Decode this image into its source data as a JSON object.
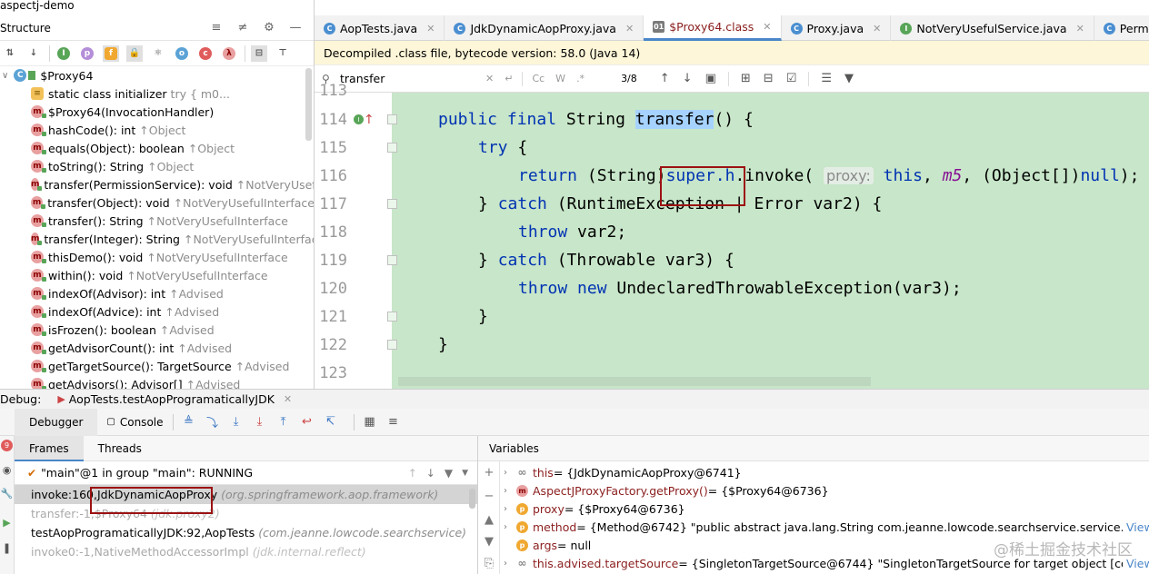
{
  "project": {
    "title": "aspectj-demo"
  },
  "structure": {
    "title": "Structure",
    "root": "$Proxy64",
    "items": [
      {
        "label": "static class initializer",
        "sub": "try {              m0...",
        "icon": "static-initializer-icon"
      },
      {
        "label": "$Proxy64(InvocationHandler)",
        "sub": "",
        "icon": "method-icon"
      },
      {
        "label": "hashCode(): int",
        "sub": "↑Object",
        "icon": "method-icon"
      },
      {
        "label": "equals(Object): boolean",
        "sub": "↑Object",
        "icon": "method-icon"
      },
      {
        "label": "toString(): String",
        "sub": "↑Object",
        "icon": "method-icon"
      },
      {
        "label": "transfer(PermissionService): void",
        "sub": "↑NotVeryUseful",
        "icon": "method-icon"
      },
      {
        "label": "transfer(Object): void",
        "sub": "↑NotVeryUsefulInterface",
        "icon": "method-icon"
      },
      {
        "label": "transfer(): String",
        "sub": "↑NotVeryUsefulInterface",
        "icon": "method-icon"
      },
      {
        "label": "transfer(Integer): String",
        "sub": "↑NotVeryUsefulInterface",
        "icon": "method-icon"
      },
      {
        "label": "thisDemo(): void",
        "sub": "↑NotVeryUsefulInterface",
        "icon": "method-icon"
      },
      {
        "label": "within(): void",
        "sub": "↑NotVeryUsefulInterface",
        "icon": "method-icon"
      },
      {
        "label": "indexOf(Advisor): int",
        "sub": "↑Advised",
        "icon": "method-icon"
      },
      {
        "label": "indexOf(Advice): int",
        "sub": "↑Advised",
        "icon": "method-icon"
      },
      {
        "label": "isFrozen(): boolean",
        "sub": "↑Advised",
        "icon": "method-icon"
      },
      {
        "label": "getAdvisorCount(): int",
        "sub": "↑Advised",
        "icon": "method-icon"
      },
      {
        "label": "getTargetSource(): TargetSource",
        "sub": "↑Advised",
        "icon": "method-icon"
      },
      {
        "label": "getAdvisors(): Advisor[]",
        "sub": "↑Advised",
        "icon": "method-icon"
      }
    ]
  },
  "editor": {
    "tabs": [
      {
        "label": "AopTests.java",
        "active": false
      },
      {
        "label": "JdkDynamicAopProxy.java",
        "active": false
      },
      {
        "label": "$Proxy64.class",
        "active": true
      },
      {
        "label": "Proxy.java",
        "active": false
      },
      {
        "label": "NotVeryUsefulService.java",
        "active": false
      },
      {
        "label": "PermissionService.ja",
        "active": false
      }
    ],
    "banner": "Decompiled .class file, bytecode version: 58.0 (Java 14)",
    "search": {
      "value": "transfer",
      "match_count": "3/8"
    },
    "lines": [
      {
        "num": "113"
      },
      {
        "num": "114"
      },
      {
        "num": "115"
      },
      {
        "num": "116"
      },
      {
        "num": "117"
      },
      {
        "num": "118"
      },
      {
        "num": "119"
      },
      {
        "num": "120"
      },
      {
        "num": "121"
      },
      {
        "num": "122"
      },
      {
        "num": "123"
      }
    ],
    "code": {
      "l114": [
        "public final ",
        "String ",
        "transfer",
        "() {"
      ],
      "l115": [
        "try",
        " {"
      ],
      "l116": [
        "return",
        " (String)",
        "super.h",
        ".invoke( ",
        "proxy:",
        " this",
        ", ",
        "m5",
        ", (Object[])",
        "null",
        ");"
      ],
      "l117": [
        "} ",
        "catch",
        " (RuntimeException | Error var2) {"
      ],
      "l118": [
        "throw",
        " var2;"
      ],
      "l119": [
        "} ",
        "catch",
        " (Throwable var3) {"
      ],
      "l120": [
        "throw",
        " ",
        "new",
        " UndeclaredThrowableException(var3);"
      ],
      "l121": [
        "}"
      ],
      "l122": [
        "}"
      ]
    }
  },
  "debug": {
    "label": "Debug:",
    "session": "AopTests.testAopProgramaticallyJDK",
    "tabs": {
      "debugger": "Debugger",
      "console": "Console"
    },
    "frames_tab": "Frames",
    "threads_tab": "Threads",
    "thread": "\"main\"@1 in group \"main\": RUNNING",
    "frames": [
      {
        "method": "invoke:160, ",
        "cls": "JdkDynamicAopProxy",
        "pkg": "(org.springframework.aop.framework)",
        "selected": true,
        "grey": false
      },
      {
        "method": "transfer:-1, ",
        "cls": "$Proxy64",
        "pkg": "(jdk.proxy2)",
        "selected": false,
        "grey": true
      },
      {
        "method": "testAopProgramaticallyJDK:92, ",
        "cls": "AopTests",
        "pkg": "(com.jeanne.lowcode.searchservice)",
        "selected": false,
        "grey": false
      },
      {
        "method": "invoke0:-1, ",
        "cls": "NativeMethodAccessorImpl",
        "pkg": "(jdk.internal.reflect)",
        "selected": false,
        "grey": true
      }
    ],
    "variables_title": "Variables",
    "variables": [
      {
        "name": "this",
        "value": " = {JdkDynamicAopProxy@6741}",
        "extra": "",
        "icon": "infinity-icon"
      },
      {
        "name": "AspectJProxyFactory.getProxy()",
        "value": " = {$Proxy64@6736}",
        "extra": "",
        "icon": "method-return-icon"
      },
      {
        "name": "proxy",
        "value": " = {$Proxy64@6736}",
        "extra": "",
        "icon": "param-icon"
      },
      {
        "name": "method",
        "value": " = {Method@6742} \"public abstract java.lang.String com.jeanne.lowcode.searchservice.service.NotVe...",
        "extra": "View",
        "icon": "param-icon"
      },
      {
        "name": "args",
        "value": " = null",
        "extra": "",
        "icon": "param-icon"
      },
      {
        "name": "this.advised.targetSource",
        "value": " = {SingletonTargetSource@6744} \"SingletonTargetSource for target object [com.je...",
        "extra": "View",
        "icon": "watch-icon"
      }
    ]
  },
  "watermark": "@稀土掘金技术社区"
}
